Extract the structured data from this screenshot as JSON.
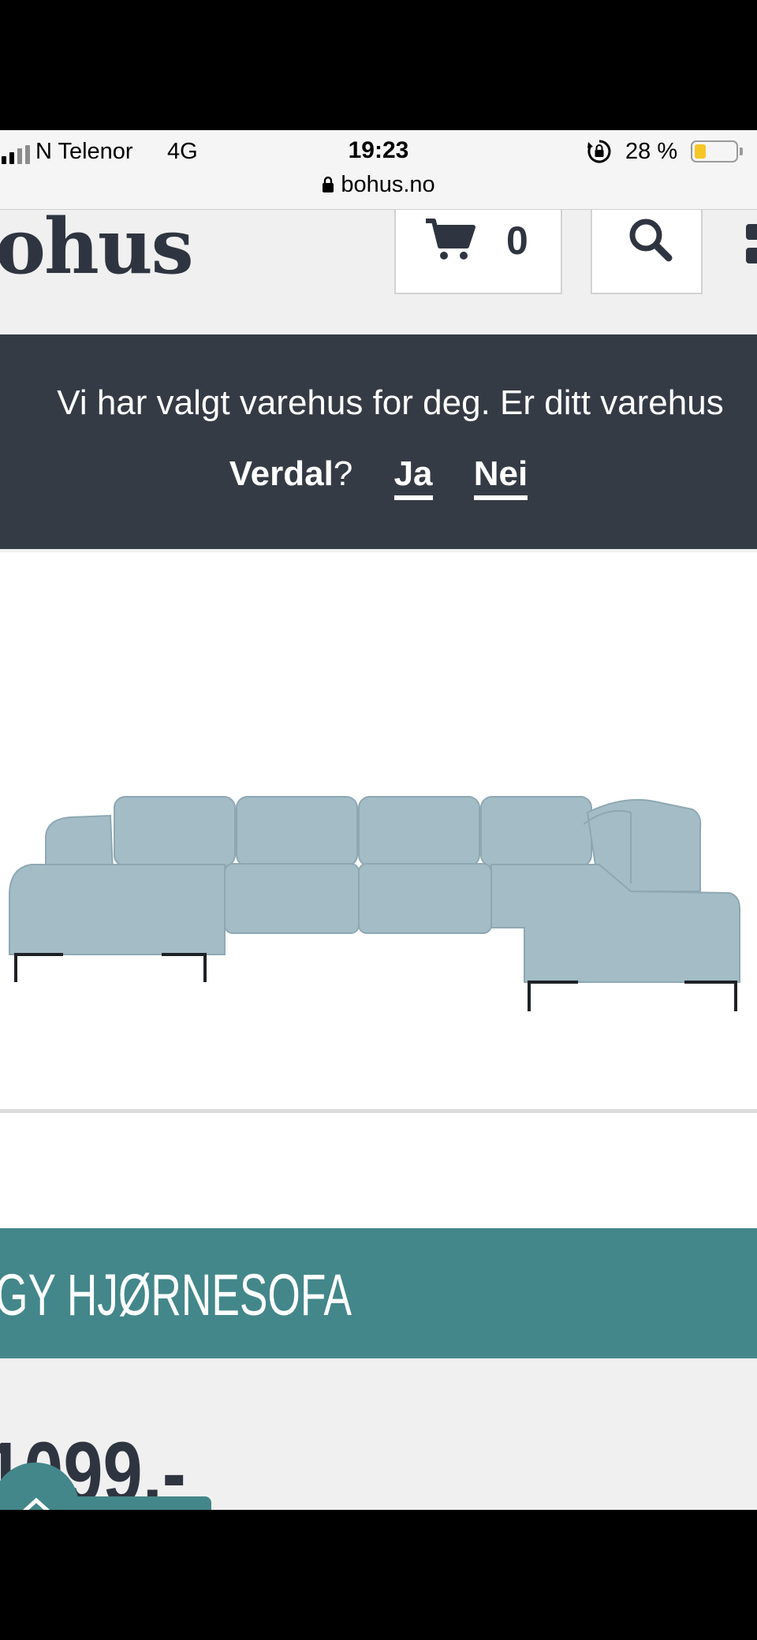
{
  "status_bar": {
    "carrier": "N Telenor",
    "network": "4G",
    "time": "19:23",
    "battery_percent_label": "28 %",
    "battery_level": 0.28,
    "url": "bohus.no"
  },
  "header": {
    "logo": "ohus",
    "cart_count": "0"
  },
  "store_banner": {
    "question": "Vi har valgt varehus for deg. Er ditt varehus",
    "store_name": "Verdal",
    "question_mark": "?",
    "yes_label": "Ja",
    "no_label": "Nei"
  },
  "product": {
    "title": "GY HJØRNESOFA",
    "price": "1099,-"
  },
  "colors": {
    "header_dark": "#353b45",
    "accent_teal": "#43878a",
    "sofa_blue": "#9fb8c2",
    "battery_yellow": "#f6c626"
  },
  "icons": [
    "signal-icon",
    "lock-icon",
    "rotation-lock-icon",
    "battery-icon",
    "cart-icon",
    "search-icon",
    "menu-icon",
    "chevron-up-icon"
  ]
}
